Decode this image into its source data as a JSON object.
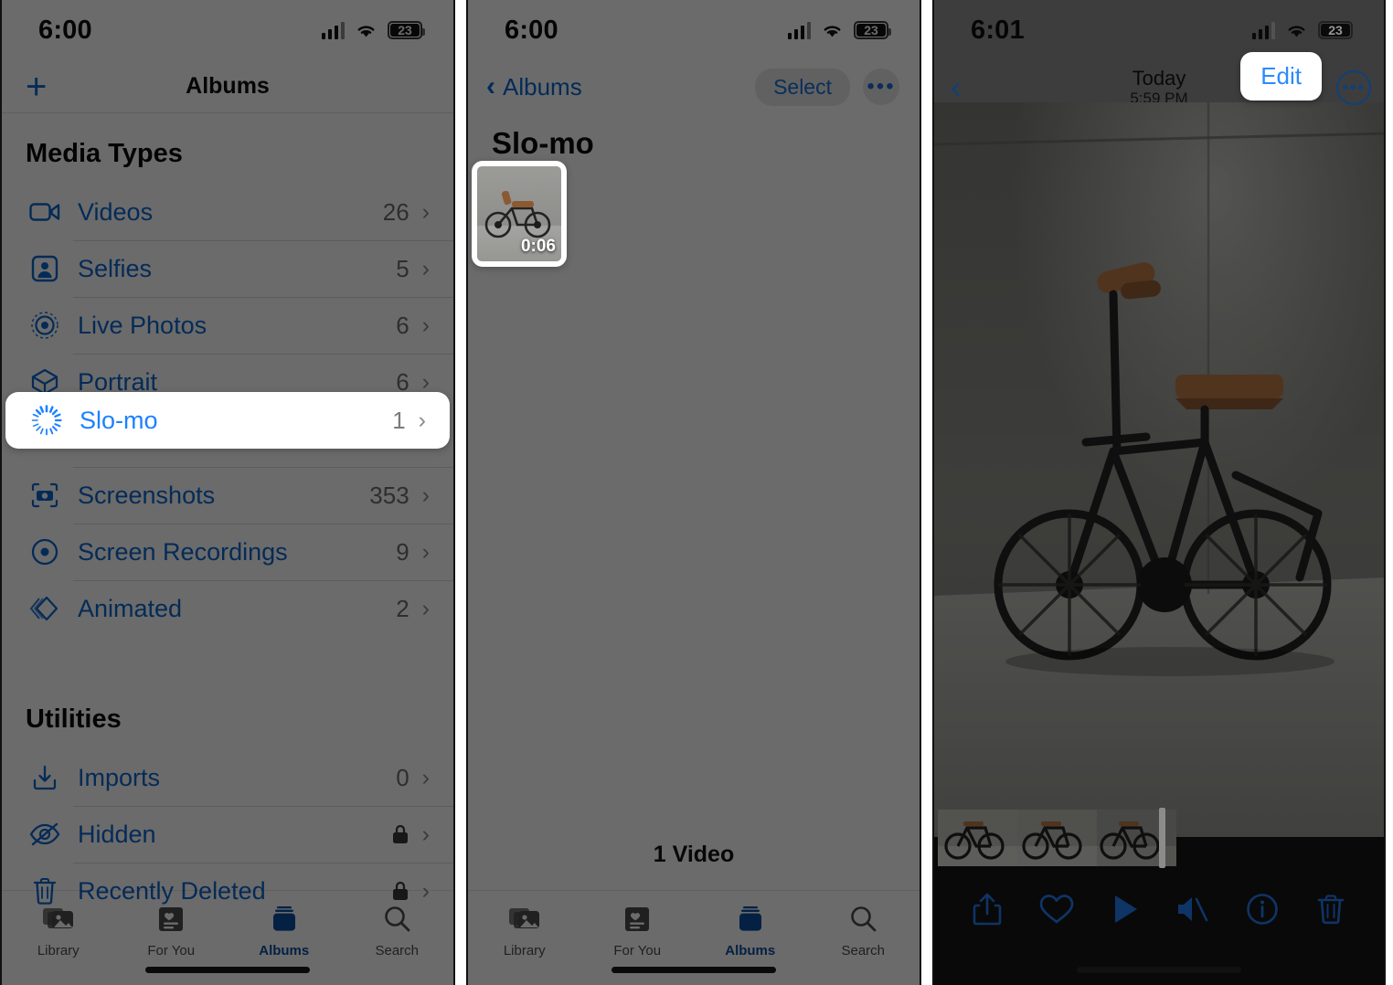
{
  "panel1": {
    "status": {
      "time": "6:00",
      "battery": "23",
      "wifi_icon": "wifi-icon",
      "cellular_icon": "cellular-bars-icon",
      "battery_icon": "battery-icon"
    },
    "nav": {
      "add_label": "+",
      "title": "Albums"
    },
    "sections": [
      {
        "header": "Media Types",
        "rows": [
          {
            "icon": "video-camera-icon",
            "label": "Videos",
            "count": "26",
            "chevron": "›"
          },
          {
            "icon": "selfie-portrait-icon",
            "label": "Selfies",
            "count": "5",
            "chevron": "›"
          },
          {
            "icon": "live-photos-icon",
            "label": "Live Photos",
            "count": "6",
            "chevron": "›"
          },
          {
            "icon": "portrait-cube-icon",
            "label": "Portrait",
            "count": "6",
            "chevron": "›"
          },
          {
            "icon": "slo-mo-icon",
            "label": "Slo-mo",
            "count": "1",
            "chevron": "›",
            "highlighted": true
          },
          {
            "icon": "screenshot-camera-icon",
            "label": "Screenshots",
            "count": "353",
            "chevron": "›"
          },
          {
            "icon": "screen-recording-icon",
            "label": "Screen Recordings",
            "count": "9",
            "chevron": "›"
          },
          {
            "icon": "animated-icon",
            "label": "Animated",
            "count": "2",
            "chevron": "›"
          }
        ]
      },
      {
        "header": "Utilities",
        "rows": [
          {
            "icon": "imports-icon",
            "label": "Imports",
            "count": "0",
            "chevron": "›"
          },
          {
            "icon": "hidden-eye-icon",
            "label": "Hidden",
            "count": "",
            "locked": true,
            "chevron": "›"
          },
          {
            "icon": "trash-icon",
            "label": "Recently Deleted",
            "count": "",
            "locked": true,
            "chevron": "›"
          }
        ]
      }
    ],
    "tabs": [
      {
        "icon": "library-icon",
        "label": "Library",
        "active": false
      },
      {
        "icon": "for-you-icon",
        "label": "For You",
        "active": false
      },
      {
        "icon": "albums-icon",
        "label": "Albums",
        "active": true
      },
      {
        "icon": "search-icon",
        "label": "Search",
        "active": false
      }
    ]
  },
  "panel2": {
    "status": {
      "time": "6:00",
      "battery": "23"
    },
    "nav": {
      "back_label": "Albums",
      "select_label": "Select",
      "more_label": "•••"
    },
    "title": "Slo-mo",
    "thumbnail": {
      "duration": "0:06",
      "alt": "black-bicycle-thumbnail"
    },
    "count_label": "1 Video",
    "tabs": [
      {
        "icon": "library-icon",
        "label": "Library",
        "active": false
      },
      {
        "icon": "for-you-icon",
        "label": "For You",
        "active": false
      },
      {
        "icon": "albums-icon",
        "label": "Albums",
        "active": true
      },
      {
        "icon": "search-icon",
        "label": "Search",
        "active": false
      }
    ]
  },
  "panel3": {
    "status": {
      "time": "6:01",
      "battery": "23"
    },
    "nav": {
      "back_icon": "chevron-left-icon",
      "date": "Today",
      "time": "5:59 PM",
      "edit_label": "Edit",
      "more_label": "•••"
    },
    "photo_alt": "black-bicycle-against-concrete-wall",
    "toolbar": [
      {
        "icon": "share-icon",
        "name": "share-button"
      },
      {
        "icon": "heart-icon",
        "name": "favorite-button"
      },
      {
        "icon": "play-icon",
        "name": "play-button"
      },
      {
        "icon": "mute-icon",
        "name": "mute-button"
      },
      {
        "icon": "info-icon",
        "name": "info-button"
      },
      {
        "icon": "trash-icon",
        "name": "delete-button"
      }
    ]
  },
  "colors": {
    "accent_blue": "#0b66d0",
    "highlight_blue": "#1b82ff",
    "dim_gray": "#636363",
    "tab_active": "#0b4fa0"
  }
}
